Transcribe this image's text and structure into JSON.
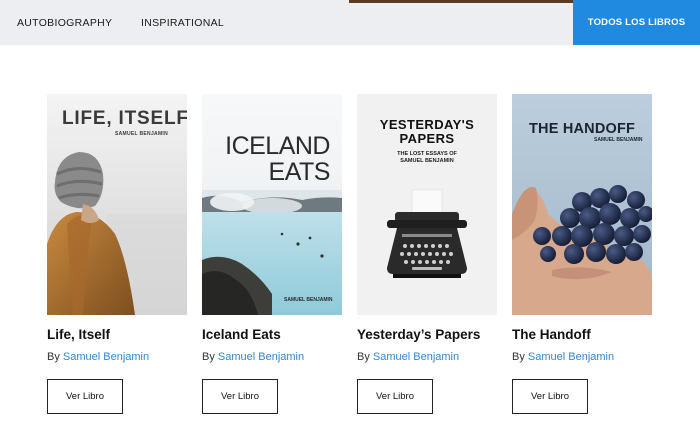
{
  "nav": {
    "items": [
      {
        "label": "AUTOBIOGRAPHY"
      },
      {
        "label": "INSPIRATIONAL"
      }
    ],
    "all_books_label": "TODOS LOS LIBROS"
  },
  "books": [
    {
      "cover_title": "LIFE, ITSELF",
      "cover_author": "SAMUEL BENJAMIN",
      "title": "Life, Itself",
      "by": "By",
      "author": "Samuel Benjamin",
      "button": "Ver Libro"
    },
    {
      "cover_title_line1": "ICELAND",
      "cover_title_line2": "EATS",
      "cover_author": "SAMUEL BENJAMIN",
      "title": "Iceland Eats",
      "by": "By",
      "author": "Samuel Benjamin",
      "button": "Ver Libro"
    },
    {
      "cover_title_line1": "YESTERDAY'S",
      "cover_title_line2": "PAPERS",
      "cover_subtitle_line1": "THE LOST ESSAYS OF",
      "cover_subtitle_line2": "SAMUEL BENJAMIN",
      "title": "Yesterday’s Papers",
      "by": "By",
      "author": "Samuel Benjamin",
      "button": "Ver Libro"
    },
    {
      "cover_title": "THE HANDOFF",
      "cover_author": "SAMUEL BENJAMIN",
      "title": "The Handoff",
      "by": "By",
      "author": "Samuel Benjamin",
      "button": "Ver Libro"
    }
  ],
  "colors": {
    "accent": "#1f8ae0",
    "link": "#2e86d6",
    "nav_bg": "#eceef1"
  }
}
